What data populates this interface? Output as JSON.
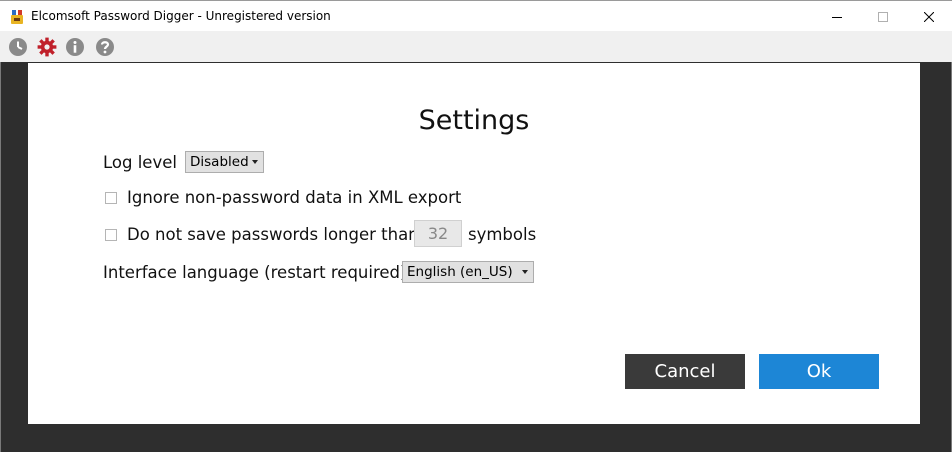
{
  "window": {
    "title": "Elcomsoft Password Digger - Unregistered version",
    "controls": [
      "minimize",
      "maximize",
      "close"
    ]
  },
  "toolbar": {
    "icons": [
      "history-icon",
      "settings-gear-icon",
      "info-icon",
      "help-icon"
    ]
  },
  "settings": {
    "title": "Settings",
    "log_level_label": "Log level",
    "log_level_value": "Disabled",
    "ignore_label": "Ignore non-password data in XML export",
    "ignore_checked": false,
    "max_length_label": "Do not save passwords longer than",
    "max_length_value": "32",
    "max_length_suffix": "symbols",
    "max_length_checked": false,
    "language_label": "Interface language (restart required)",
    "language_value": "English (en_US)"
  },
  "buttons": {
    "cancel": "Cancel",
    "ok": "Ok"
  },
  "colors": {
    "accent": "#1d86d6",
    "cancel_bg": "#3a3a3a",
    "gear_active": "#c0202a",
    "toolbar_icon": "#8a8a8a",
    "frame": "#2e2e2e"
  }
}
